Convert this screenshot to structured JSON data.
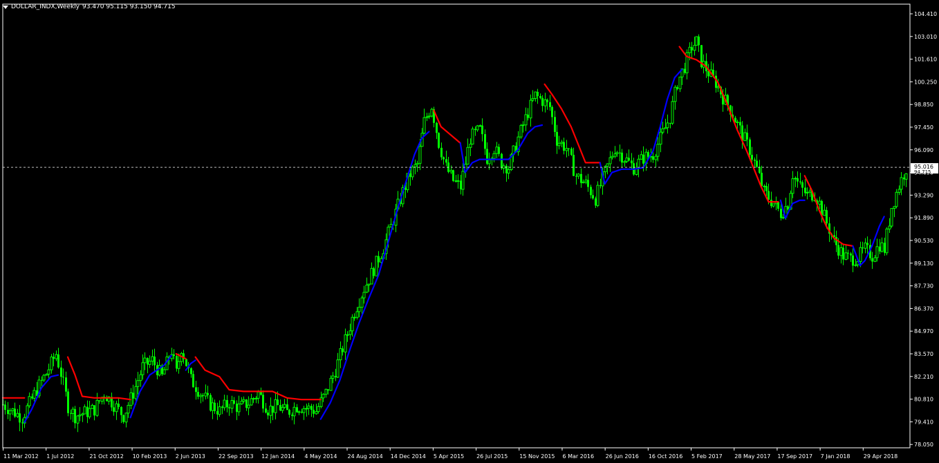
{
  "header": {
    "symbol": "DOLLAR_INDX,Weekly",
    "ohlc": "93.470 95.115 93.150 94.715",
    "menu_icon": "triangle-down-icon"
  },
  "colors": {
    "background": "#000000",
    "candles": "#00ff00",
    "line_down": "#ff0000",
    "line_up": "#0000ff",
    "axis": "#ffffff",
    "price_line": "#c0c0c0"
  },
  "chart_data": {
    "type": "line",
    "y_ticks": [
      "104.410",
      "103.010",
      "101.610",
      "100.250",
      "98.850",
      "97.450",
      "96.090",
      "94.690",
      "93.290",
      "91.890",
      "90.530",
      "89.130",
      "87.730",
      "86.370",
      "84.970",
      "83.570",
      "82.210",
      "80.810",
      "79.410",
      "78.050"
    ],
    "x_ticks": [
      "11 Mar 2012",
      "1 Jul 2012",
      "21 Oct 2012",
      "10 Feb 2013",
      "2 Jun 2013",
      "22 Sep 2013",
      "12 Jan 2014",
      "4 May 2014",
      "24 Aug 2014",
      "14 Dec 2014",
      "5 Apr 2015",
      "26 Jul 2015",
      "15 Nov 2015",
      "6 Mar 2016",
      "26 Jun 2016",
      "16 Oct 2016",
      "5 Feb 2017",
      "28 May 2017",
      "17 Sep 2017",
      "7 Jan 2018",
      "29 Apr 2018"
    ],
    "current_price": "95.016",
    "current_close": "94.715",
    "ylim": [
      77.6,
      105.3
    ],
    "price_path": [
      [
        0,
        80.5
      ],
      [
        8,
        79.7
      ],
      [
        14,
        81.4
      ],
      [
        18,
        82.4
      ],
      [
        22,
        83.6
      ],
      [
        24,
        82.4
      ],
      [
        27,
        80.4
      ],
      [
        30,
        79.8
      ],
      [
        34,
        80.0
      ],
      [
        38,
        80.2
      ],
      [
        42,
        81.2
      ],
      [
        46,
        80.5
      ],
      [
        50,
        79.8
      ],
      [
        54,
        81.2
      ],
      [
        58,
        82.8
      ],
      [
        62,
        83.2
      ],
      [
        66,
        82.2
      ],
      [
        70,
        83.8
      ],
      [
        72,
        82.4
      ],
      [
        74,
        84.0
      ],
      [
        78,
        82.0
      ],
      [
        82,
        81.2
      ],
      [
        86,
        80.5
      ],
      [
        90,
        80.1
      ],
      [
        94,
        80.6
      ],
      [
        98,
        80.3
      ],
      [
        102,
        80.6
      ],
      [
        106,
        81.2
      ],
      [
        110,
        80.2
      ],
      [
        114,
        80.4
      ],
      [
        118,
        80.0
      ],
      [
        122,
        80.4
      ],
      [
        126,
        80.3
      ],
      [
        130,
        80.1
      ],
      [
        134,
        81.2
      ],
      [
        138,
        82.6
      ],
      [
        142,
        84.4
      ],
      [
        146,
        86.2
      ],
      [
        150,
        87.6
      ],
      [
        154,
        88.8
      ],
      [
        158,
        90.1
      ],
      [
        162,
        91.8
      ],
      [
        166,
        93.5
      ],
      [
        169,
        94.6
      ],
      [
        172,
        95.2
      ],
      [
        175,
        97.8
      ],
      [
        178,
        98.8
      ],
      [
        181,
        96.5
      ],
      [
        184,
        95.0
      ],
      [
        187,
        94.2
      ],
      [
        190,
        93.8
      ],
      [
        194,
        96.8
      ],
      [
        198,
        97.3
      ],
      [
        201,
        95.6
      ],
      [
        204,
        96.2
      ],
      [
        207,
        95.3
      ],
      [
        210,
        95.0
      ],
      [
        214,
        96.8
      ],
      [
        218,
        98.4
      ],
      [
        221,
        99.4
      ],
      [
        224,
        99.1
      ],
      [
        227,
        98.7
      ],
      [
        230,
        96.7
      ],
      [
        234,
        96.2
      ],
      [
        238,
        94.5
      ],
      [
        242,
        94.0
      ],
      [
        246,
        93.1
      ],
      [
        250,
        94.7
      ],
      [
        254,
        96.2
      ],
      [
        258,
        95.6
      ],
      [
        262,
        95.0
      ],
      [
        266,
        95.6
      ],
      [
        270,
        95.8
      ],
      [
        274,
        97.1
      ],
      [
        277,
        98.1
      ],
      [
        280,
        100.2
      ],
      [
        283,
        101.2
      ],
      [
        286,
        102.4
      ],
      [
        288,
        102.7
      ],
      [
        290,
        101.5
      ],
      [
        293,
        100.8
      ],
      [
        296,
        100.2
      ],
      [
        299,
        99.3
      ],
      [
        302,
        98.6
      ],
      [
        306,
        97.3
      ],
      [
        310,
        96.1
      ],
      [
        313,
        94.9
      ],
      [
        316,
        93.5
      ],
      [
        320,
        92.8
      ],
      [
        323,
        92.2
      ],
      [
        326,
        92.8
      ],
      [
        328,
        94.6
      ],
      [
        331,
        93.8
      ],
      [
        334,
        93.3
      ],
      [
        337,
        93.4
      ],
      [
        339,
        92.8
      ],
      [
        342,
        91.6
      ],
      [
        345,
        90.5
      ],
      [
        349,
        89.6
      ],
      [
        352,
        89.4
      ],
      [
        355,
        89.5
      ],
      [
        358,
        90.0
      ],
      [
        361,
        89.6
      ],
      [
        364,
        90.3
      ],
      [
        366,
        90.0
      ],
      [
        369,
        92.6
      ],
      [
        372,
        93.9
      ],
      [
        375,
        95.0
      ]
    ],
    "line_down": [
      [
        [
          0,
          80.9
        ],
        [
          9,
          80.9
        ],
        [
          9,
          80.9
        ]
      ],
      [
        [
          27,
          83.4
        ],
        [
          30,
          82.3
        ],
        [
          33,
          81.0
        ],
        [
          38,
          80.9
        ],
        [
          42,
          80.9
        ],
        [
          48,
          80.9
        ],
        [
          53,
          80.8
        ]
      ],
      [
        [
          72,
          83.6
        ],
        [
          76,
          83.3
        ]
      ],
      [
        [
          80,
          83.4
        ],
        [
          84,
          82.6
        ],
        [
          90,
          82.2
        ],
        [
          94,
          81.4
        ],
        [
          100,
          81.3
        ],
        [
          106,
          81.3
        ],
        [
          112,
          81.3
        ],
        [
          118,
          80.9
        ],
        [
          124,
          80.8
        ],
        [
          132,
          80.8
        ]
      ],
      [
        [
          179,
          98.5
        ],
        [
          182,
          97.5
        ],
        [
          186,
          97.0
        ],
        [
          190,
          96.5
        ]
      ],
      [
        [
          225,
          100.1
        ],
        [
          228,
          99.5
        ],
        [
          232,
          98.6
        ],
        [
          236,
          97.5
        ],
        [
          239,
          96.4
        ],
        [
          242,
          95.3
        ],
        [
          245,
          95.3
        ],
        [
          248,
          95.3
        ]
      ],
      [
        [
          281,
          102.4
        ],
        [
          284,
          101.8
        ],
        [
          288,
          101.6
        ],
        [
          292,
          101.2
        ],
        [
          297,
          100.2
        ],
        [
          301,
          98.8
        ],
        [
          305,
          97.3
        ],
        [
          309,
          96.0
        ],
        [
          312,
          94.9
        ],
        [
          315,
          93.8
        ],
        [
          318,
          92.9
        ],
        [
          322,
          92.9
        ]
      ],
      [
        [
          333,
          94.5
        ],
        [
          336,
          93.6
        ],
        [
          339,
          92.4
        ],
        [
          342,
          91.4
        ],
        [
          345,
          90.7
        ],
        [
          349,
          90.3
        ],
        [
          353,
          90.2
        ]
      ]
    ],
    "line_up": [
      [
        [
          9,
          79.4
        ],
        [
          12,
          80.2
        ],
        [
          16,
          81.5
        ],
        [
          20,
          82.2
        ],
        [
          23,
          82.3
        ]
      ],
      [
        [
          53,
          79.7
        ],
        [
          57,
          81.3
        ],
        [
          61,
          82.3
        ],
        [
          64,
          82.6
        ],
        [
          67,
          82.9
        ],
        [
          70,
          83.5
        ]
      ],
      [
        [
          76,
          82.6
        ],
        [
          78,
          83.0
        ],
        [
          80,
          83.2
        ]
      ],
      [
        [
          132,
          79.6
        ],
        [
          136,
          80.6
        ],
        [
          140,
          82.0
        ],
        [
          144,
          83.8
        ],
        [
          148,
          85.5
        ],
        [
          152,
          87.0
        ],
        [
          156,
          88.4
        ],
        [
          160,
          90.4
        ],
        [
          164,
          92.5
        ],
        [
          168,
          94.4
        ],
        [
          171,
          95.8
        ],
        [
          174,
          96.8
        ],
        [
          177,
          97.2
        ]
      ],
      [
        [
          190,
          96.5
        ],
        [
          192,
          94.7
        ],
        [
          195,
          95.3
        ],
        [
          198,
          95.5
        ],
        [
          203,
          95.5
        ],
        [
          210,
          95.5
        ],
        [
          214,
          96.1
        ],
        [
          218,
          97.1
        ],
        [
          221,
          97.5
        ],
        [
          224,
          97.6
        ]
      ],
      [
        [
          248,
          95.3
        ],
        [
          250,
          94.0
        ],
        [
          253,
          94.7
        ],
        [
          257,
          94.9
        ],
        [
          262,
          94.9
        ],
        [
          266,
          95.0
        ],
        [
          270,
          96.0
        ],
        [
          273,
          97.5
        ],
        [
          276,
          99.2
        ],
        [
          279,
          100.5
        ],
        [
          282,
          101.0
        ]
      ],
      [
        [
          323,
          93.0
        ],
        [
          325,
          91.9
        ],
        [
          328,
          92.8
        ],
        [
          331,
          93.0
        ],
        [
          333,
          93.0
        ]
      ],
      [
        [
          353,
          90.2
        ],
        [
          356,
          89.0
        ],
        [
          358,
          89.3
        ],
        [
          361,
          90.2
        ],
        [
          364,
          91.4
        ],
        [
          366,
          92.0
        ]
      ]
    ]
  }
}
